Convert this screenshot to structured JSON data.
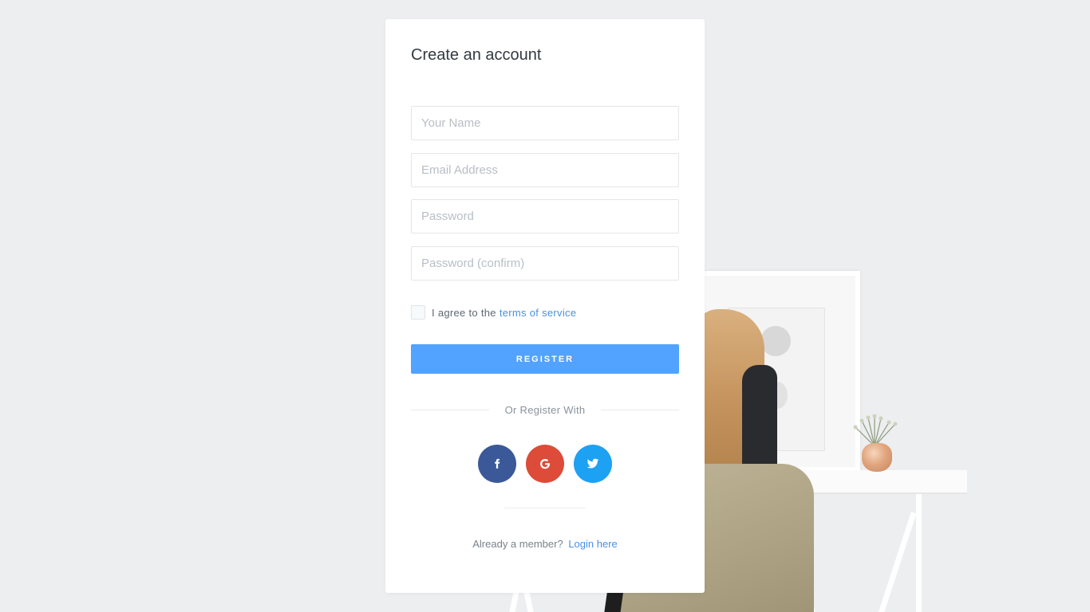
{
  "form": {
    "title": "Create an account",
    "fields": {
      "name": {
        "placeholder": "Your Name",
        "value": ""
      },
      "email": {
        "placeholder": "Email Address",
        "value": ""
      },
      "password": {
        "placeholder": "Password",
        "value": ""
      },
      "password_confirm": {
        "placeholder": "Password (confirm)",
        "value": ""
      }
    },
    "agree": {
      "text": "I agree to the",
      "link": "terms of service",
      "checked": false
    },
    "register_label": "REGISTER",
    "divider_text": "Or Register With",
    "social": [
      {
        "name": "facebook",
        "icon": "facebook-icon",
        "glyph": "f",
        "color": "#3b5998"
      },
      {
        "name": "google",
        "icon": "google-icon",
        "glyph": "G",
        "color": "#dd4b39"
      },
      {
        "name": "twitter",
        "icon": "twitter-icon",
        "glyph": "twitter-bird",
        "color": "#1da1f2"
      }
    ],
    "member_text": "Already a member?",
    "login_link": "Login here"
  },
  "colors": {
    "accent": "#52a2ff",
    "link": "#4a90e2",
    "background": "#edeef0"
  }
}
